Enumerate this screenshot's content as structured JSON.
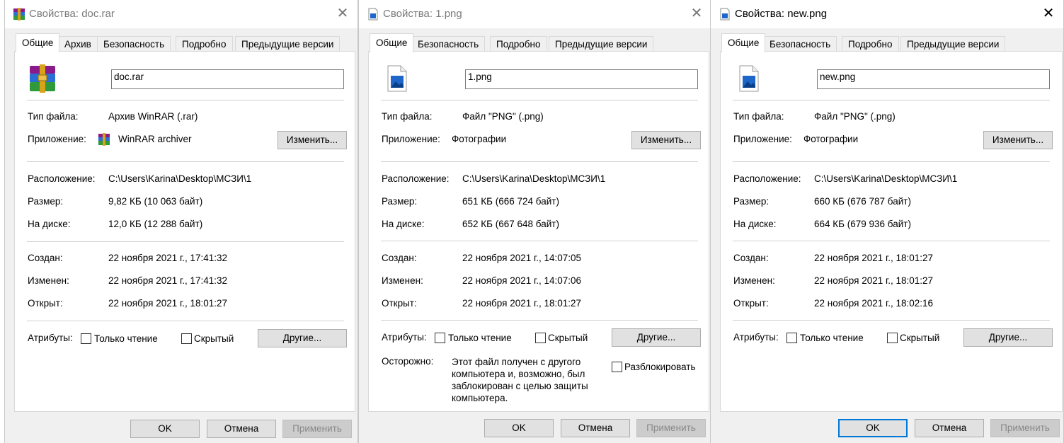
{
  "common": {
    "tabs_rar": [
      "Общие",
      "Архив",
      "Безопасность",
      "Подробно",
      "Предыдущие версии"
    ],
    "tabs_png": [
      "Общие",
      "Безопасность",
      "Подробно",
      "Предыдущие версии"
    ],
    "labels": {
      "type": "Тип файла:",
      "app": "Приложение:",
      "location": "Расположение:",
      "size": "Размер:",
      "disk": "На диске:",
      "created": "Создан:",
      "modified": "Изменен:",
      "accessed": "Открыт:",
      "attributes": "Атрибуты:",
      "readonly": "Только чтение",
      "hidden": "Скрытый",
      "warning": "Осторожно:",
      "unblock": "Разблокировать"
    },
    "buttons": {
      "change": "Изменить...",
      "other": "Другие...",
      "ok": "OK",
      "cancel": "Отмена",
      "apply": "Применить"
    },
    "close_glyph": "✕"
  },
  "win1": {
    "title": "Свойства: doc.rar",
    "filename": "doc.rar",
    "type": "Архив WinRAR (.rar)",
    "app": "WinRAR archiver",
    "location": "C:\\Users\\Karina\\Desktop\\МСЗИ\\1",
    "size": "9,82 КБ (10 063 байт)",
    "disk": "12,0 КБ (12 288 байт)",
    "created": "22 ноября 2021 г., 17:41:32",
    "modified": "22 ноября 2021 г., 17:41:32",
    "accessed": "22 ноября 2021 г., 18:01:27",
    "icon": "winrar-archive-icon"
  },
  "win2": {
    "title": "Свойства: 1.png",
    "filename": "1.png",
    "type": "Файл \"PNG\" (.png)",
    "app": "Фотографии",
    "location": "C:\\Users\\Karina\\Desktop\\МСЗИ\\1",
    "size": "651 КБ (666 724 байт)",
    "disk": "652 КБ (667 648 байт)",
    "created": "22 ноября 2021 г., 14:07:05",
    "modified": "22 ноября 2021 г., 14:07:06",
    "accessed": "22 ноября 2021 г., 18:01:27",
    "warning_text": "Этот файл получен с другого компьютера и, возможно, был заблокирован с целью защиты компьютера.",
    "icon": "png-image-icon"
  },
  "win3": {
    "title": "Свойства: new.png",
    "filename": "new.png",
    "type": "Файл \"PNG\" (.png)",
    "app": "Фотографии",
    "location": "C:\\Users\\Karina\\Desktop\\МСЗИ\\1",
    "size": "660 КБ (676 787 байт)",
    "disk": "664 КБ (679 936 байт)",
    "created": "22 ноября 2021 г., 18:01:27",
    "modified": "22 ноября 2021 г., 18:01:27",
    "accessed": "22 ноября 2021 г., 18:02:16",
    "icon": "png-image-icon"
  }
}
